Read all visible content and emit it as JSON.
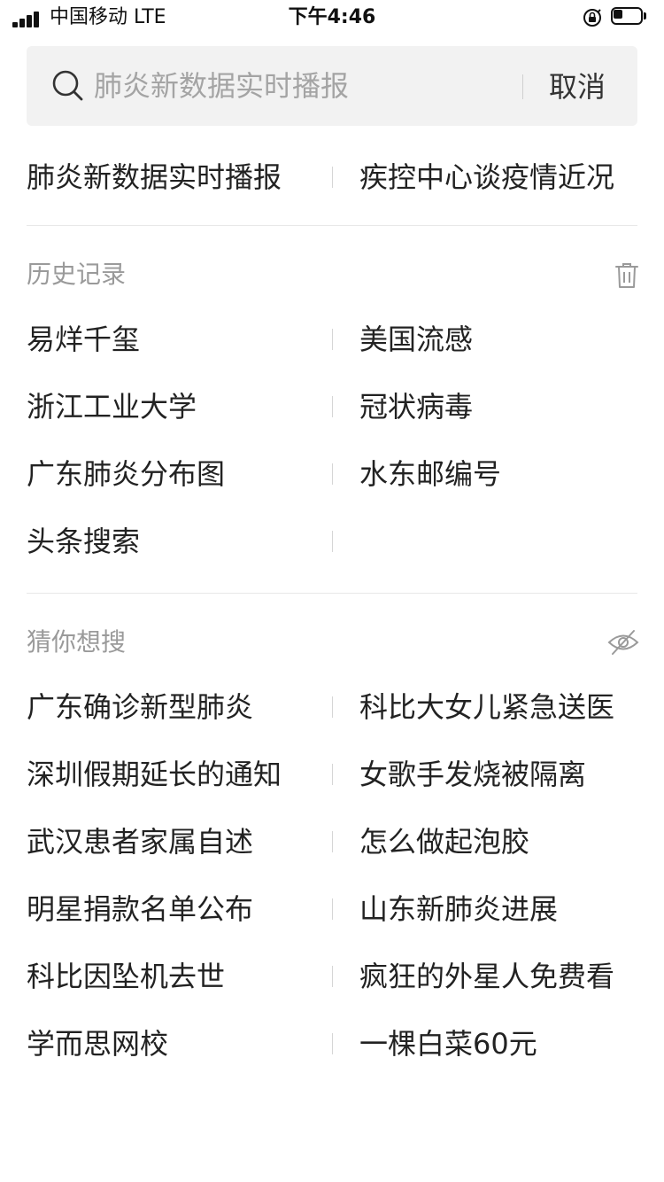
{
  "status_bar": {
    "carrier": "中国移动  LTE",
    "time": "下午4:46",
    "icons": [
      "signal-icon",
      "rotation-lock-icon",
      "battery-icon"
    ]
  },
  "search": {
    "placeholder": "肺炎新数据实时播报",
    "value": "",
    "cancel_label": "取消",
    "icon": "search-icon"
  },
  "top_suggestions": [
    {
      "label": "肺炎新数据实时播报"
    },
    {
      "label": "疾控中心谈疫情近况"
    }
  ],
  "history": {
    "title": "历史记录",
    "clear_icon": "trash-icon",
    "items": [
      {
        "label": "易烊千玺"
      },
      {
        "label": "美国流感"
      },
      {
        "label": "浙江工业大学"
      },
      {
        "label": "冠状病毒"
      },
      {
        "label": "广东肺炎分布图"
      },
      {
        "label": "水东邮编号"
      },
      {
        "label": "头条搜索"
      }
    ]
  },
  "guess": {
    "title": "猜你想搜",
    "hide_icon": "eye-off-icon",
    "items": [
      {
        "label": "广东确诊新型肺炎"
      },
      {
        "label": "科比大女儿紧急送医"
      },
      {
        "label": "深圳假期延长的通知"
      },
      {
        "label": "女歌手发烧被隔离"
      },
      {
        "label": "武汉患者家属自述"
      },
      {
        "label": "怎么做起泡胶"
      },
      {
        "label": "明星捐款名单公布"
      },
      {
        "label": "山东新肺炎进展"
      },
      {
        "label": "科比因坠机去世"
      },
      {
        "label": "疯狂的外星人免费看"
      },
      {
        "label": "学而思网校"
      },
      {
        "label": "一棵白菜60元"
      }
    ]
  },
  "colors": {
    "search_bg": "#f2f2f2",
    "text": "#222222",
    "secondary_text": "#9a9a9a",
    "divider": "#e8e8e8"
  }
}
